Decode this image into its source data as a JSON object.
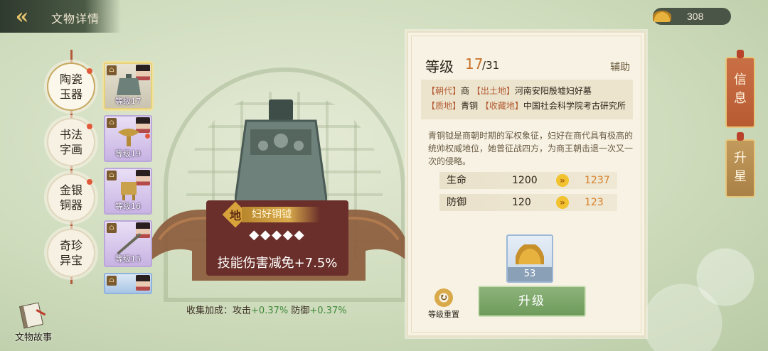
{
  "header": {
    "title": "文物详情",
    "currency_amount": "308"
  },
  "categories": [
    {
      "label": "陶瓷玉器",
      "active": true,
      "badge": true
    },
    {
      "label": "书法字画",
      "active": false,
      "badge": true
    },
    {
      "label": "金银铜器",
      "active": false,
      "badge": true
    },
    {
      "label": "奇珍异宝",
      "active": false,
      "badge": false
    }
  ],
  "items": [
    {
      "level": "等级17",
      "selected": true
    },
    {
      "level": "等级19",
      "selected": false
    },
    {
      "level": "等级16",
      "selected": false
    },
    {
      "level": "等级15",
      "selected": false
    }
  ],
  "artifact": {
    "grade": "地",
    "name": "妇好铜钺",
    "stars": "◆◆◆◆◆",
    "skill": "技能伤害减免+7.5%"
  },
  "collection_bonus": {
    "label": "收集加成：",
    "attack_label": "攻击",
    "attack_value": "+0.37%",
    "defense_label": "防御",
    "defense_value": "+0.37%"
  },
  "story_button": "文物故事",
  "panel": {
    "level_label": "等级",
    "level_current": "17",
    "level_max": "/31",
    "role": "辅助",
    "meta": {
      "dynasty_key": "【朝代】",
      "dynasty": "商",
      "origin_key": "【出土地】",
      "origin": "河南安阳殷墟妇好墓",
      "material_key": "【质地】",
      "material": "青铜",
      "collection_key": "【收藏地】",
      "collection": "中国社会科学院考古研究所"
    },
    "description": "青铜钺是商朝时期的军权象征，妇好在商代具有极高的统帅权威地位，她曾征战四方，为商王朝击退一次又一次的侵略。",
    "stats": [
      {
        "name": "生命",
        "value": "1200",
        "next": "1237"
      },
      {
        "name": "防御",
        "value": "120",
        "next": "123"
      }
    ],
    "material_count": "53",
    "reset_label": "等级重置",
    "upgrade_label": "升级"
  },
  "side_tabs": [
    {
      "label": "信息",
      "active": true
    },
    {
      "label": "升星",
      "active": false
    }
  ],
  "colors": {
    "accent_orange": "#c9702a",
    "upgrade_green": "#6e9b5c",
    "plate_red": "#6a2f2a",
    "bonus_green": "#3f8a3b"
  }
}
